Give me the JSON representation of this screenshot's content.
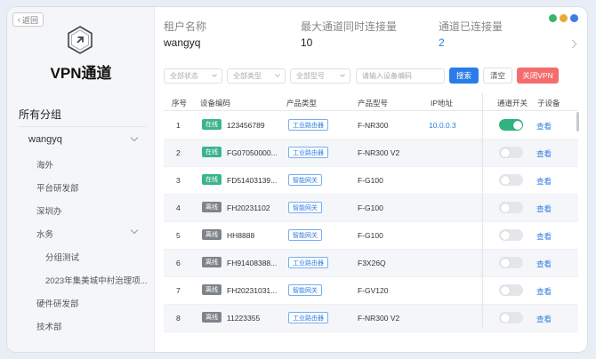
{
  "sidebar": {
    "back_label": "返回",
    "brand": "VPN通道",
    "group_title": "所有分组",
    "tree": [
      {
        "label": "wangyq",
        "level": 0,
        "expanded": true
      },
      {
        "label": "海外",
        "level": 1
      },
      {
        "label": "平台研发部",
        "level": 1
      },
      {
        "label": "深圳办",
        "level": 1
      },
      {
        "label": "水务",
        "level": 1,
        "expanded": true
      },
      {
        "label": "分组测试",
        "level": 2
      },
      {
        "label": "2023年集美城中村治理项...",
        "level": 2
      },
      {
        "label": "硬件研发部",
        "level": 1
      },
      {
        "label": "技术部",
        "level": 1
      }
    ]
  },
  "header": {
    "tenant_label": "租户名称",
    "tenant_value": "wangyq",
    "max_label": "最大通道同时连接量",
    "max_value": "10",
    "connected_label": "通道已连接量",
    "connected_value": "2"
  },
  "filters": {
    "status_placeholder": "全部状态",
    "type_placeholder": "全部类型",
    "model_placeholder": "全部型号",
    "code_placeholder": "请输入设备编码",
    "search_label": "搜索",
    "clear_label": "清空",
    "close_vpn_label": "关闭VPN"
  },
  "table": {
    "headers": {
      "index": "序号",
      "code": "设备编码",
      "type": "产品类型",
      "model": "产品型号",
      "ip": "IP地址",
      "switch": "通道开关",
      "sub": "子设备"
    },
    "rows": [
      {
        "index": "1",
        "status": "在线",
        "online": true,
        "code": "123456789",
        "type": "工业路由器",
        "model": "F-NR300",
        "ip": "10.0.0.3",
        "switch_on": true,
        "sub": "查看"
      },
      {
        "index": "2",
        "status": "在线",
        "online": true,
        "code": "FG07050000...",
        "type": "工业路由器",
        "model": "F-NR300 V2",
        "ip": "",
        "switch_on": false,
        "sub": "查看"
      },
      {
        "index": "3",
        "status": "在线",
        "online": true,
        "code": "FD51403139...",
        "type": "智能网关",
        "model": "F-G100",
        "ip": "",
        "switch_on": false,
        "sub": "查看"
      },
      {
        "index": "4",
        "status": "离线",
        "online": false,
        "code": "FH20231102",
        "type": "智能网关",
        "model": "F-G100",
        "ip": "",
        "switch_on": false,
        "sub": "查看"
      },
      {
        "index": "5",
        "status": "离线",
        "online": false,
        "code": "HH8888",
        "type": "智能网关",
        "model": "F-G100",
        "ip": "",
        "switch_on": false,
        "sub": "查看"
      },
      {
        "index": "6",
        "status": "离线",
        "online": false,
        "code": "FH91408388...",
        "type": "工业路由器",
        "model": "F3X26Q",
        "ip": "",
        "switch_on": false,
        "sub": "查看"
      },
      {
        "index": "7",
        "status": "离线",
        "online": false,
        "code": "FH20231031...",
        "type": "智能网关",
        "model": "F-GV120",
        "ip": "",
        "switch_on": false,
        "sub": "查看"
      },
      {
        "index": "8",
        "status": "离线",
        "online": false,
        "code": "11223355",
        "type": "工业路由器",
        "model": "F-NR300 V2",
        "ip": "",
        "switch_on": false,
        "sub": "查看"
      }
    ]
  },
  "colors": {
    "accent": "#2b7ce9",
    "online": "#3cb48c",
    "offline": "#7f8489",
    "danger": "#f36d6d"
  }
}
